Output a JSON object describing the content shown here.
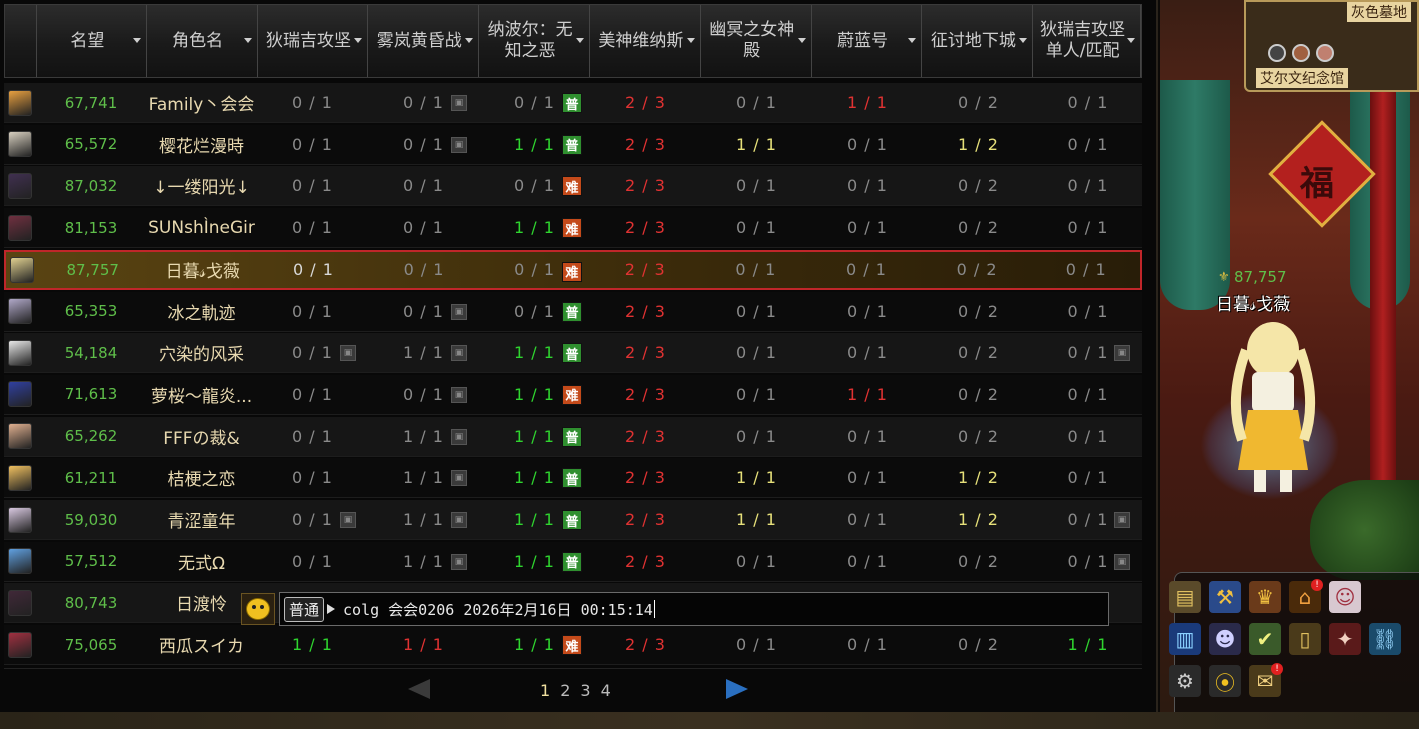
{
  "columns": [
    {
      "key": "avatar",
      "label": "",
      "sortable": false
    },
    {
      "key": "fame",
      "label": "名望",
      "sortable": true
    },
    {
      "key": "name",
      "label": "角色名",
      "sortable": true
    },
    {
      "key": "d1",
      "label": "狄瑞吉攻坚",
      "sortable": true
    },
    {
      "key": "d2",
      "label": "雾岚黄昏战",
      "sortable": true
    },
    {
      "key": "d3",
      "label": "纳波尔：无知之恶",
      "sortable": true
    },
    {
      "key": "d4",
      "label": "美神维纳斯",
      "sortable": true
    },
    {
      "key": "d5",
      "label": "幽冥之女神殿",
      "sortable": true
    },
    {
      "key": "d6",
      "label": "蔚蓝号",
      "sortable": true
    },
    {
      "key": "d7",
      "label": "征讨地下城",
      "sortable": true
    },
    {
      "key": "d8",
      "label": "狄瑞吉攻坚单人/匹配",
      "sortable": true
    }
  ],
  "rows": [
    {
      "avatar_color": "#e8a040",
      "fame": "67,741",
      "name": "Family丶会会",
      "cells": [
        {
          "text": "0 / 1",
          "color": "grey"
        },
        {
          "text": "0 / 1",
          "color": "grey",
          "lock": true
        },
        {
          "text": "0 / 1",
          "color": "grey",
          "badge": "普"
        },
        {
          "text": "2 / 3",
          "color": "red"
        },
        {
          "text": "0 / 1",
          "color": "grey"
        },
        {
          "text": "1 / 1",
          "color": "red"
        },
        {
          "text": "0 / 2",
          "color": "grey"
        },
        {
          "text": "0 / 1",
          "color": "grey"
        }
      ]
    },
    {
      "avatar_color": "#d8d0c0",
      "fame": "65,572",
      "name": "樱花烂漫時",
      "cells": [
        {
          "text": "0 / 1",
          "color": "grey"
        },
        {
          "text": "0 / 1",
          "color": "grey",
          "lock": true
        },
        {
          "text": "1 / 1",
          "color": "green",
          "badge": "普"
        },
        {
          "text": "2 / 3",
          "color": "red"
        },
        {
          "text": "1 / 1",
          "color": "yellow"
        },
        {
          "text": "0 / 1",
          "color": "grey"
        },
        {
          "text": "1 / 2",
          "color": "yellow"
        },
        {
          "text": "0 / 1",
          "color": "grey"
        }
      ]
    },
    {
      "avatar_color": "#403050",
      "fame": "87,032",
      "name": "↓一缕阳光↓",
      "cells": [
        {
          "text": "0 / 1",
          "color": "grey"
        },
        {
          "text": "0 / 1",
          "color": "grey"
        },
        {
          "text": "0 / 1",
          "color": "grey",
          "badge": "难"
        },
        {
          "text": "2 / 3",
          "color": "red"
        },
        {
          "text": "0 / 1",
          "color": "grey"
        },
        {
          "text": "0 / 1",
          "color": "grey"
        },
        {
          "text": "0 / 2",
          "color": "grey"
        },
        {
          "text": "0 / 1",
          "color": "grey"
        }
      ]
    },
    {
      "avatar_color": "#703040",
      "fame": "81,153",
      "name": "SUNshÌneGir",
      "cells": [
        {
          "text": "0 / 1",
          "color": "grey"
        },
        {
          "text": "0 / 1",
          "color": "grey"
        },
        {
          "text": "1 / 1",
          "color": "green",
          "badge": "难"
        },
        {
          "text": "2 / 3",
          "color": "red"
        },
        {
          "text": "0 / 1",
          "color": "grey"
        },
        {
          "text": "0 / 1",
          "color": "grey"
        },
        {
          "text": "0 / 2",
          "color": "grey"
        },
        {
          "text": "0 / 1",
          "color": "grey"
        }
      ]
    },
    {
      "avatar_color": "#e0d090",
      "fame": "87,757",
      "name": "日暮𝓈戈薇",
      "selected": true,
      "cells": [
        {
          "text": "0 / 1",
          "color": "white"
        },
        {
          "text": "0 / 1",
          "color": "grey"
        },
        {
          "text": "0 / 1",
          "color": "grey",
          "badge": "难"
        },
        {
          "text": "2 / 3",
          "color": "red"
        },
        {
          "text": "0 / 1",
          "color": "grey"
        },
        {
          "text": "0 / 1",
          "color": "grey"
        },
        {
          "text": "0 / 2",
          "color": "grey"
        },
        {
          "text": "0 / 1",
          "color": "grey"
        }
      ]
    },
    {
      "avatar_color": "#b0a8c8",
      "fame": "65,353",
      "name": "冰之軌迹",
      "cells": [
        {
          "text": "0 / 1",
          "color": "grey"
        },
        {
          "text": "0 / 1",
          "color": "grey",
          "lock": true
        },
        {
          "text": "0 / 1",
          "color": "grey",
          "badge": "普"
        },
        {
          "text": "2 / 3",
          "color": "red"
        },
        {
          "text": "0 / 1",
          "color": "grey"
        },
        {
          "text": "0 / 1",
          "color": "grey"
        },
        {
          "text": "0 / 2",
          "color": "grey"
        },
        {
          "text": "0 / 1",
          "color": "grey"
        }
      ]
    },
    {
      "avatar_color": "#e8e8e8",
      "fame": "54,184",
      "name": "穴染的风采",
      "cells": [
        {
          "text": "0 / 1",
          "color": "grey",
          "lock": true
        },
        {
          "text": "1 / 1",
          "color": "grey",
          "lock": true
        },
        {
          "text": "1 / 1",
          "color": "green",
          "badge": "普"
        },
        {
          "text": "2 / 3",
          "color": "red"
        },
        {
          "text": "0 / 1",
          "color": "grey"
        },
        {
          "text": "0 / 1",
          "color": "grey"
        },
        {
          "text": "0 / 2",
          "color": "grey"
        },
        {
          "text": "0 / 1",
          "color": "grey",
          "lock": true
        }
      ]
    },
    {
      "avatar_color": "#3040a0",
      "fame": "71,613",
      "name": "萝桜～龍炎...",
      "cells": [
        {
          "text": "0 / 1",
          "color": "grey"
        },
        {
          "text": "0 / 1",
          "color": "grey",
          "lock": true
        },
        {
          "text": "1 / 1",
          "color": "green",
          "badge": "难"
        },
        {
          "text": "2 / 3",
          "color": "red"
        },
        {
          "text": "0 / 1",
          "color": "grey"
        },
        {
          "text": "1 / 1",
          "color": "red"
        },
        {
          "text": "0 / 2",
          "color": "grey"
        },
        {
          "text": "0 / 1",
          "color": "grey"
        }
      ]
    },
    {
      "avatar_color": "#e0b090",
      "fame": "65,262",
      "name": "FFFの裁&",
      "cells": [
        {
          "text": "0 / 1",
          "color": "grey"
        },
        {
          "text": "1 / 1",
          "color": "grey",
          "lock": true
        },
        {
          "text": "1 / 1",
          "color": "green",
          "badge": "普"
        },
        {
          "text": "2 / 3",
          "color": "red"
        },
        {
          "text": "0 / 1",
          "color": "grey"
        },
        {
          "text": "0 / 1",
          "color": "grey"
        },
        {
          "text": "0 / 2",
          "color": "grey"
        },
        {
          "text": "0 / 1",
          "color": "grey"
        }
      ]
    },
    {
      "avatar_color": "#f0c060",
      "fame": "61,211",
      "name": "桔梗之恋",
      "cells": [
        {
          "text": "0 / 1",
          "color": "grey"
        },
        {
          "text": "1 / 1",
          "color": "grey",
          "lock": true
        },
        {
          "text": "1 / 1",
          "color": "green",
          "badge": "普"
        },
        {
          "text": "2 / 3",
          "color": "red"
        },
        {
          "text": "1 / 1",
          "color": "yellow"
        },
        {
          "text": "0 / 1",
          "color": "grey"
        },
        {
          "text": "1 / 2",
          "color": "yellow"
        },
        {
          "text": "0 / 1",
          "color": "grey"
        }
      ]
    },
    {
      "avatar_color": "#d8c8e0",
      "fame": "59,030",
      "name": "青涩童年",
      "cells": [
        {
          "text": "0 / 1",
          "color": "grey",
          "lock": true
        },
        {
          "text": "1 / 1",
          "color": "grey",
          "lock": true
        },
        {
          "text": "1 / 1",
          "color": "green",
          "badge": "普"
        },
        {
          "text": "2 / 3",
          "color": "red"
        },
        {
          "text": "1 / 1",
          "color": "yellow"
        },
        {
          "text": "0 / 1",
          "color": "grey"
        },
        {
          "text": "1 / 2",
          "color": "yellow"
        },
        {
          "text": "0 / 1",
          "color": "grey",
          "lock": true
        }
      ]
    },
    {
      "avatar_color": "#60a0e0",
      "fame": "57,512",
      "name": "无式Ω",
      "cells": [
        {
          "text": "0 / 1",
          "color": "grey"
        },
        {
          "text": "1 / 1",
          "color": "grey",
          "lock": true
        },
        {
          "text": "1 / 1",
          "color": "green",
          "badge": "普"
        },
        {
          "text": "2 / 3",
          "color": "red"
        },
        {
          "text": "0 / 1",
          "color": "grey"
        },
        {
          "text": "0 / 1",
          "color": "grey"
        },
        {
          "text": "0 / 2",
          "color": "grey"
        },
        {
          "text": "0 / 1",
          "color": "grey",
          "lock": true
        }
      ]
    },
    {
      "avatar_color": "#402838",
      "fame": "80,743",
      "name": "日渡怜",
      "cells": []
    },
    {
      "avatar_color": "#a03040",
      "fame": "75,065",
      "name": "西瓜スイカ",
      "cells": [
        {
          "text": "1 / 1",
          "color": "green"
        },
        {
          "text": "1 / 1",
          "color": "red"
        },
        {
          "text": "1 / 1",
          "color": "green",
          "badge": "难"
        },
        {
          "text": "2 / 3",
          "color": "red"
        },
        {
          "text": "0 / 1",
          "color": "grey"
        },
        {
          "text": "0 / 1",
          "color": "grey"
        },
        {
          "text": "0 / 2",
          "color": "grey"
        },
        {
          "text": "1 / 1",
          "color": "green"
        }
      ]
    }
  ],
  "chat": {
    "channel": "普通",
    "text": "colg 会会0206 2026年2月16日 00:15:14",
    "emoji_icon": "emoji-face-icon"
  },
  "pagination": {
    "pages": [
      "1",
      "2",
      "3",
      "4"
    ],
    "current": "1"
  },
  "game": {
    "minimap_top": "灰色墓地",
    "minimap_bottom": "艾尔文纪念馆",
    "character_fame": "87,757",
    "character_name": "日暮𝓈戈薇",
    "fu_char": "福"
  },
  "colors": {
    "fame": "#5fbf4a",
    "green": "#2fd42f",
    "red": "#e03232",
    "yellow": "#e6e07a",
    "grey": "#8a8a8a",
    "white": "#d8d8d8",
    "selected_border": "#c0262a",
    "badge_pu": "#2f8f2f",
    "badge_nan": "#c44a1a"
  }
}
